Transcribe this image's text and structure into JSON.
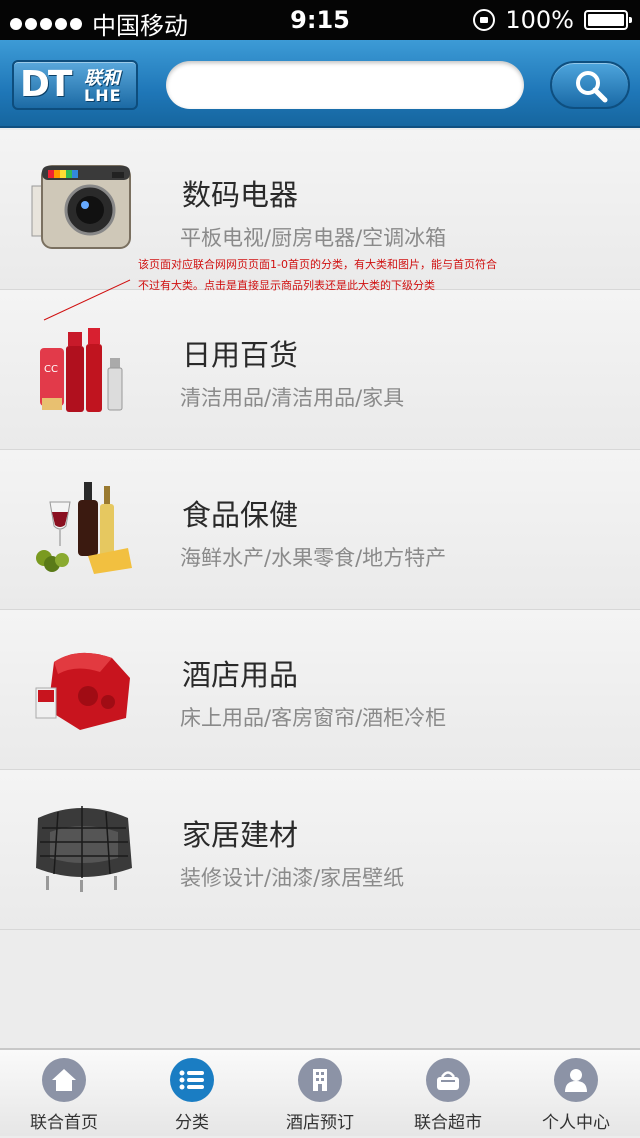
{
  "status_bar": {
    "carrier": "中国移动",
    "time": "9:15",
    "battery": "100%"
  },
  "header": {
    "logo_main": "DT",
    "logo_cn": "联和",
    "logo_en": "LHE",
    "search_placeholder": ""
  },
  "categories": [
    {
      "title": "数码电器",
      "sub": "平板电视/厨房电器/空调冰箱",
      "icon": "camera-icon"
    },
    {
      "title": "日用百货",
      "sub": "清洁用品/清洁用品/家具",
      "icon": "cosmetics-icon"
    },
    {
      "title": "食品保健",
      "sub": "海鲜水产/水果零食/地方特产",
      "icon": "wine-food-icon"
    },
    {
      "title": "酒店用品",
      "sub": "床上用品/客房窗帘/酒柜冷柜",
      "icon": "bedding-icon"
    },
    {
      "title": "家居建材",
      "sub": "装修设计/油漆/家居壁纸",
      "icon": "armchair-icon"
    }
  ],
  "annotation": {
    "line1": "该页面对应联合网网页页面1-0首页的分类，有大类和图片，能与首页符合",
    "line2": "不过有大类。点击是直接显示商品列表还是此大类的下级分类"
  },
  "tabbar": {
    "items": [
      {
        "label": "联合首页",
        "icon": "home-icon",
        "active": false
      },
      {
        "label": "分类",
        "icon": "list-icon",
        "active": true
      },
      {
        "label": "酒店预订",
        "icon": "building-icon",
        "active": false
      },
      {
        "label": "联合超市",
        "icon": "basket-icon",
        "active": false
      },
      {
        "label": "个人中心",
        "icon": "user-icon",
        "active": false
      }
    ]
  },
  "colors": {
    "header_blue": "#1f77b8",
    "active_tab": "#1a7dc3",
    "inactive_tab": "#8c93a6",
    "annotation_red": "#d01010"
  }
}
